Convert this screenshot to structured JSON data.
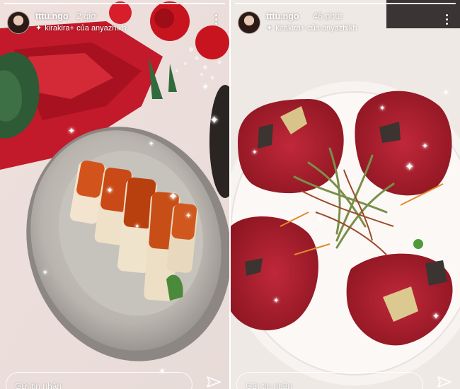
{
  "stories": [
    {
      "username": "tttu.ngo",
      "time": "2 giờ",
      "music": "kirakira+ của anyazhikh",
      "reply_placeholder": "Gửi tin nhắn",
      "progress": 1.0,
      "photo": "sushi roll with fish roe on a grey stone plate, red flowers and red napkin in background"
    },
    {
      "username": "tttu.ngo",
      "time": "46 phút",
      "music": "kirakira+ của anyazhikh",
      "reply_placeholder": "Gửi tin nhắn",
      "progress": 1.0,
      "photo": "beef carpaccio slices with gold leaf and microgreens salad on a white plate"
    }
  ],
  "icons": {
    "music": "sparkle-music-icon",
    "more": "more-vertical-icon",
    "send": "send-icon"
  }
}
